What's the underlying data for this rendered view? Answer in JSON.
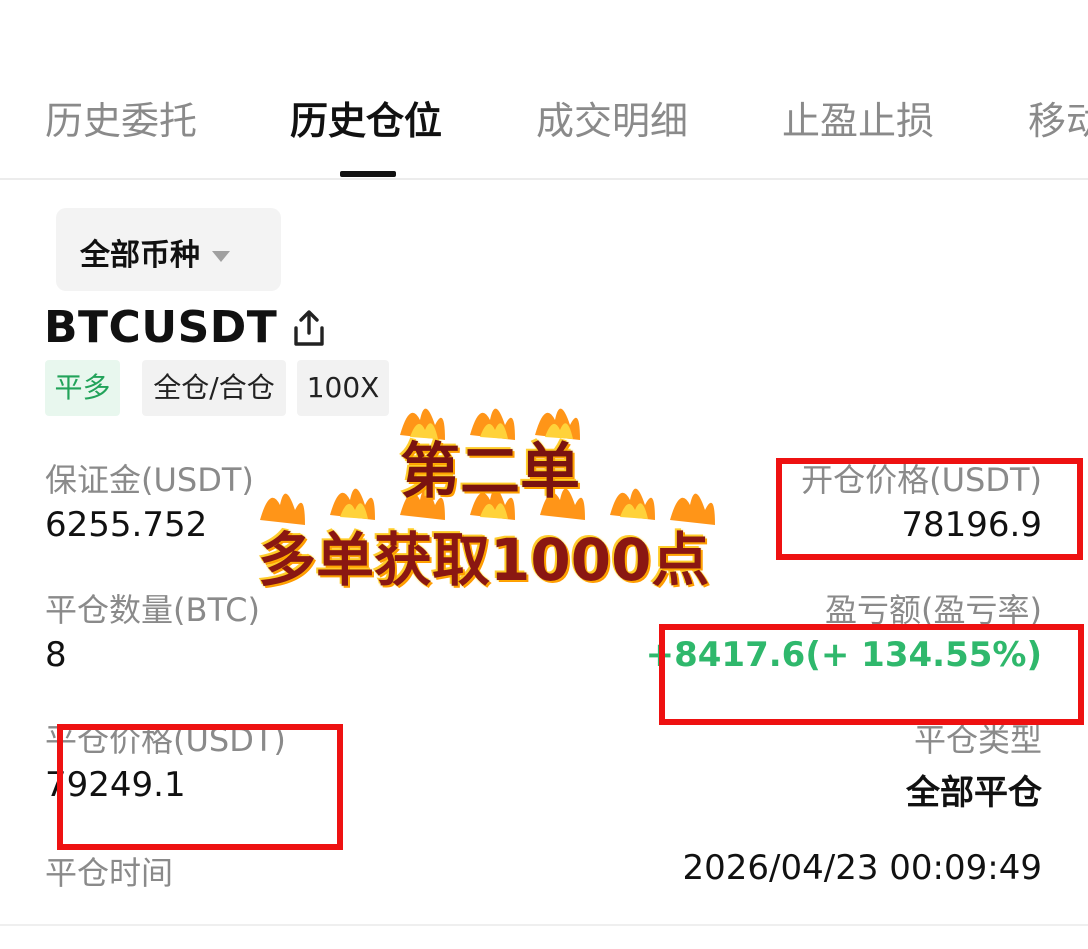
{
  "tabs": [
    {
      "label": "历史委托",
      "active": false
    },
    {
      "label": "历史仓位",
      "active": true
    },
    {
      "label": "成交明细",
      "active": false
    },
    {
      "label": "止盈止损",
      "active": false
    },
    {
      "label": "移动",
      "active": false
    }
  ],
  "filter": {
    "label": "全部币种"
  },
  "position": {
    "symbol": "BTCUSDT",
    "badges": [
      "平多",
      "全仓/合仓",
      "100X"
    ],
    "margin_label": "保证金(USDT)",
    "margin_value": "6255.752",
    "open_price_label": "开仓价格(USDT)",
    "open_price_value": "78196.9",
    "close_qty_label": "平仓数量(BTC)",
    "close_qty_value": "8",
    "pnl_label": "盈亏额(盈亏率)",
    "pnl_value": "+8417.6(+ 134.55%)",
    "close_price_label": "平仓价格(USDT)",
    "close_price_value": "79249.1",
    "close_type_label": "平仓类型",
    "close_type_value": "全部平仓",
    "close_time_label": "平仓时间",
    "close_time_value": "2026/04/23 00:09:49"
  },
  "overlay": {
    "line1": "第二单",
    "line2": "多单获取1000点"
  },
  "colors": {
    "profit_green": "#2fb86c",
    "annotation_red": "#ee1111",
    "long_badge_bg": "#e8f7ee"
  }
}
